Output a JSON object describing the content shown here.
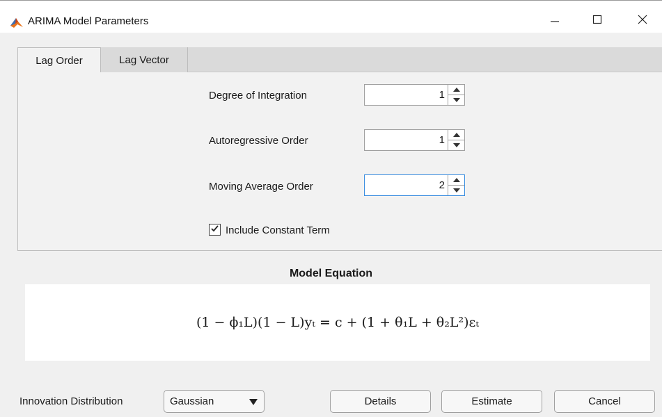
{
  "window": {
    "title": "ARIMA Model Parameters",
    "accent_color": "#3b8ee0"
  },
  "tabs": [
    {
      "label": "Lag Order",
      "selected": true
    },
    {
      "label": "Lag Vector",
      "selected": false
    }
  ],
  "lag_order": {
    "degree_of_integration": {
      "label": "Degree of Integration",
      "value": "1"
    },
    "autoregressive_order": {
      "label": "Autoregressive Order",
      "value": "1"
    },
    "moving_average_order": {
      "label": "Moving Average Order",
      "value": "2"
    },
    "include_constant": {
      "label": "Include Constant Term",
      "checked": true
    }
  },
  "model_equation": {
    "heading": "Model Equation",
    "equation_text": "(1 − ϕ₁L)(1 − L)yₜ = c + (1 + θ₁L + θ₂L²)εₜ"
  },
  "footer": {
    "innovation_label": "Innovation Distribution",
    "innovation_value": "Gaussian",
    "details_label": "Details",
    "estimate_label": "Estimate",
    "cancel_label": "Cancel"
  },
  "icons": {
    "app": "matlab-icon",
    "minimize": "minimize-icon",
    "maximize": "maximize-icon",
    "close": "close-icon"
  }
}
